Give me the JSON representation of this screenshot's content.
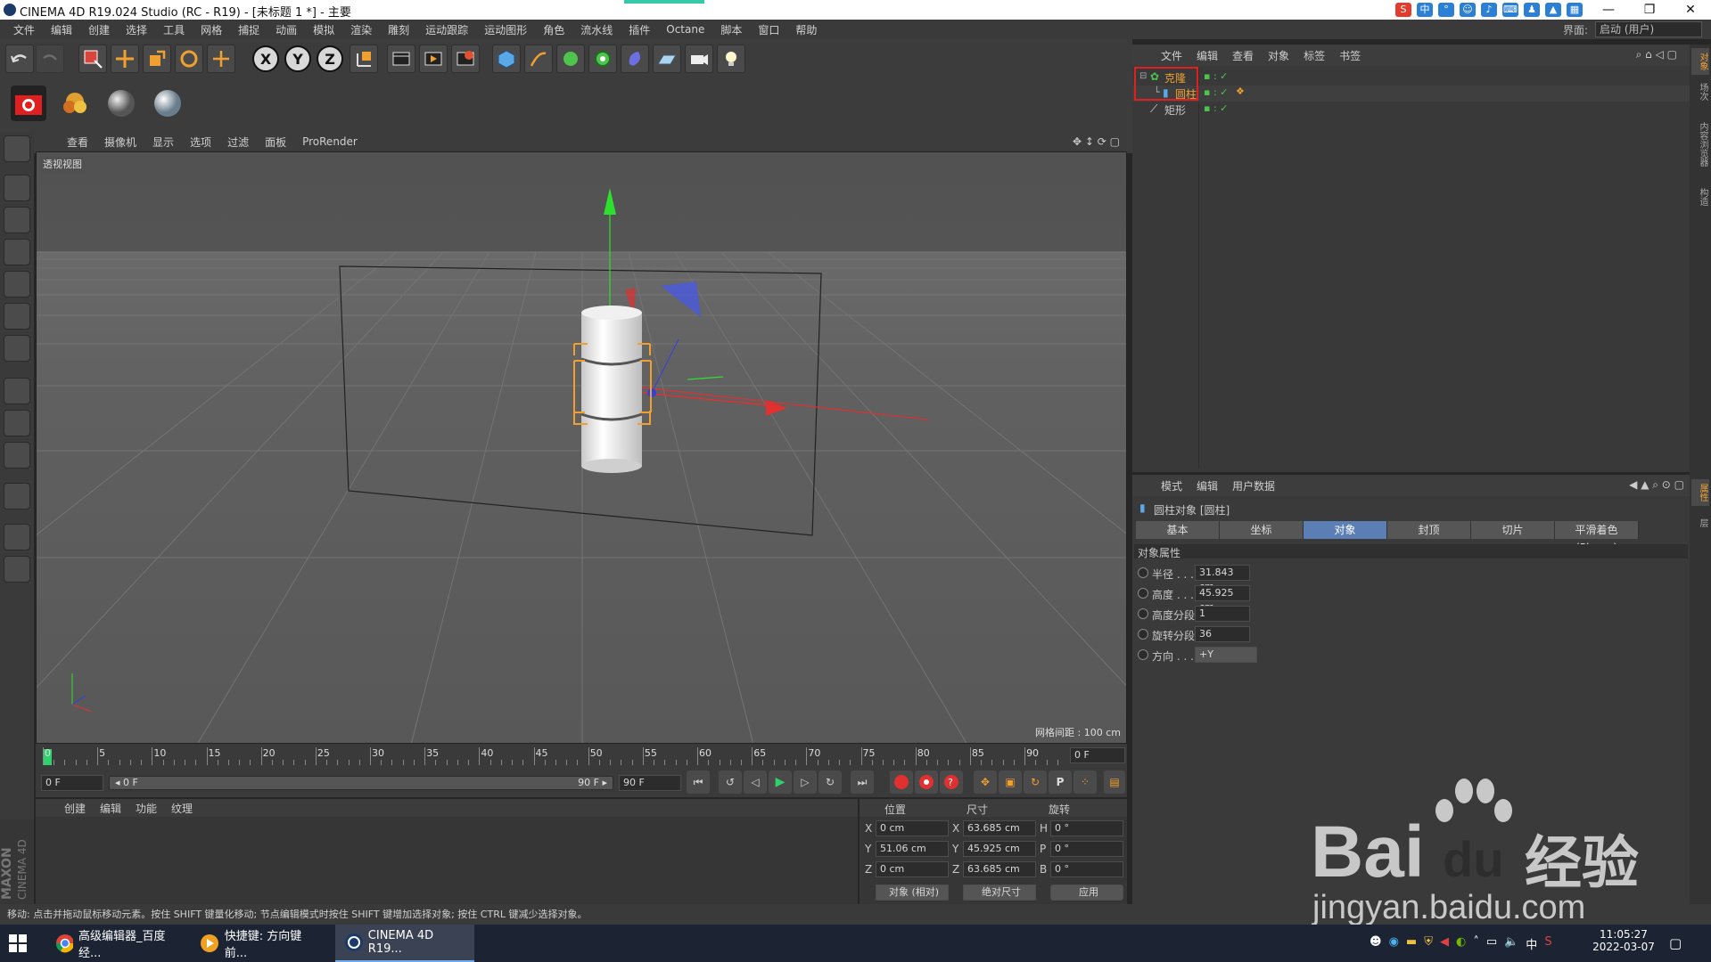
{
  "window": {
    "title": "CINEMA 4D R19.024 Studio (RC - R19) - [未标题 1 *] - 主要",
    "minimize": "—",
    "maximize": "❐",
    "close": "✕"
  },
  "menu": {
    "items": [
      "文件",
      "编辑",
      "创建",
      "选择",
      "工具",
      "网格",
      "捕捉",
      "动画",
      "模拟",
      "渲染",
      "雕刻",
      "运动跟踪",
      "运动图形",
      "角色",
      "流水线",
      "插件",
      "Octane",
      "脚本",
      "窗口",
      "帮助"
    ],
    "layout_label": "界面:",
    "layout_value": "启动 (用户)"
  },
  "toolbar": {
    "axis_x": "X",
    "axis_y": "Y",
    "axis_z": "Z"
  },
  "viewport": {
    "menus": [
      "查看",
      "摄像机",
      "显示",
      "选项",
      "过滤",
      "面板",
      "ProRender"
    ],
    "view_name": "透视视图",
    "grid_spacing": "网格间距 : 100 cm"
  },
  "timeline": {
    "ticks": [
      "0",
      "5",
      "10",
      "15",
      "20",
      "25",
      "30",
      "35",
      "40",
      "45",
      "50",
      "55",
      "60",
      "65",
      "70",
      "75",
      "80",
      "85",
      "90"
    ],
    "current_frame": "0 F"
  },
  "transport": {
    "start_field": "0 F",
    "range_start": "◂ 0 F",
    "range_end": "90 F ▸",
    "end_field": "90 F"
  },
  "material_panel": {
    "menus": [
      "创建",
      "编辑",
      "功能",
      "纹理"
    ],
    "logo_line1": "MAXON",
    "logo_line2": "CINEMA 4D"
  },
  "coords": {
    "headers": {
      "position": "位置",
      "size": "尺寸",
      "rotation": "旋转"
    },
    "rows": [
      {
        "axis": "X",
        "pos": "0 cm",
        "size_axis": "X",
        "size": "63.685 cm",
        "rot_axis": "H",
        "rot": "0 °"
      },
      {
        "axis": "Y",
        "pos": "51.06 cm",
        "size_axis": "Y",
        "size": "45.925 cm",
        "rot_axis": "P",
        "rot": "0 °"
      },
      {
        "axis": "Z",
        "pos": "0 cm",
        "size_axis": "Z",
        "size": "63.685 cm",
        "rot_axis": "B",
        "rot": "0 °"
      }
    ],
    "mode_select": "对象 (相对)",
    "size_select": "绝对尺寸",
    "apply": "应用"
  },
  "status": {
    "text": "移动: 点击并拖动鼠标移动元素。按住 SHIFT 键量化移动; 节点编辑模式时按住 SHIFT 键增加选择对象; 按住 CTRL 键减少选择对象。"
  },
  "object_manager": {
    "menus": [
      "文件",
      "编辑",
      "查看",
      "对象",
      "标签",
      "书签"
    ],
    "objects": [
      {
        "name": "克隆",
        "level": 0,
        "selected": true
      },
      {
        "name": "圆柱",
        "level": 1,
        "selected": true
      },
      {
        "name": "矩形",
        "level": 0,
        "selected": false
      }
    ]
  },
  "attribute_manager": {
    "menus": [
      "模式",
      "编辑",
      "用户数据"
    ],
    "object_title": "圆柱对象 [圆柱]",
    "tabs": [
      "基本",
      "坐标",
      "对象",
      "封顶",
      "切片",
      "平滑着色(Phong)"
    ],
    "active_tab": "对象",
    "section": "对象属性",
    "props": [
      {
        "label": "半径 . . .",
        "value": "31.843 cm"
      },
      {
        "label": "高度 . . .",
        "value": "45.925 cm"
      },
      {
        "label": "高度分段",
        "value": "1"
      },
      {
        "label": "旋转分段",
        "value": "36"
      },
      {
        "label": "方向 . . .",
        "value": "+Y"
      }
    ]
  },
  "right_strip": {
    "tabs": [
      "对象",
      "场次",
      "内容浏览器",
      "构造",
      "属性",
      "层"
    ]
  },
  "taskbar": {
    "apps": [
      "高级编辑器_百度经...",
      "快捷键: 方向键前...",
      "CINEMA 4D R19..."
    ],
    "time": "11:05:27",
    "date": "2022-03-07",
    "ime": "中"
  },
  "watermark": {
    "brand": "Bai",
    "paw": "du",
    "cn": "经验",
    "url": "jingyan.baidu.com"
  }
}
